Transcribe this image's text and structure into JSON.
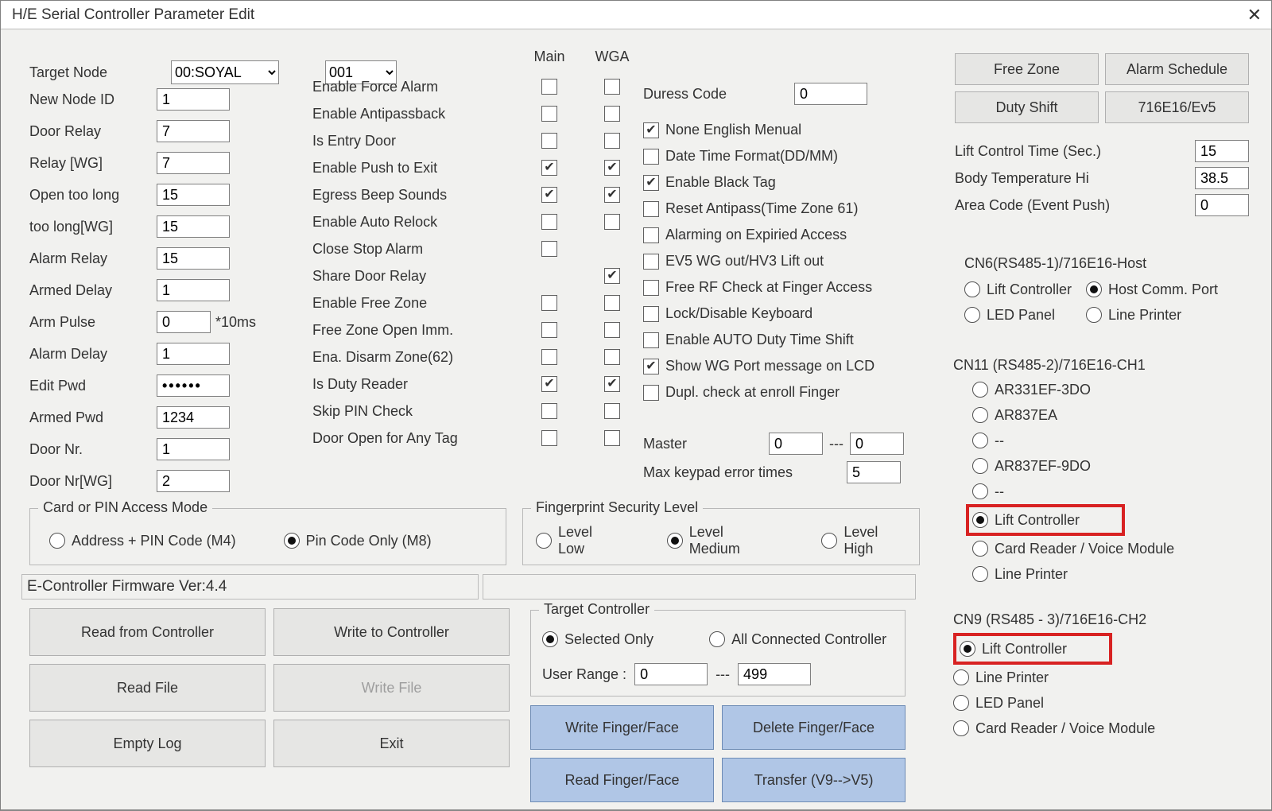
{
  "title": "H/E Serial Controller  Parameter Edit",
  "targetNode": {
    "label": "Target Node",
    "combo1": "00:SOYAL",
    "combo2": "001"
  },
  "leftParams": [
    {
      "label": "New Node ID",
      "value": "1"
    },
    {
      "label": "Door Relay",
      "value": "7"
    },
    {
      "label": "Relay [WG]",
      "value": "7"
    },
    {
      "label": "Open too long",
      "value": "15"
    },
    {
      "label": "too long[WG]",
      "value": "15"
    },
    {
      "label": "Alarm Relay",
      "value": "15"
    },
    {
      "label": "Armed Delay",
      "value": "1"
    },
    {
      "label": "Arm Pulse",
      "value": "0",
      "suffix": "*10ms",
      "narrow": true
    },
    {
      "label": "Alarm Delay",
      "value": "1"
    },
    {
      "label": "Edit Pwd",
      "value": "••••••",
      "pw": true
    },
    {
      "label": "Armed Pwd",
      "value": "1234"
    },
    {
      "label": "Door Nr.",
      "value": "1"
    },
    {
      "label": "Door Nr[WG]",
      "value": "2"
    }
  ],
  "midHdr": {
    "main": "Main",
    "wga": "WGA"
  },
  "midRows": [
    {
      "label": "Enable Force Alarm",
      "m": false,
      "w": false
    },
    {
      "label": "Enable Antipassback",
      "m": false,
      "w": false
    },
    {
      "label": "Is Entry Door",
      "m": false,
      "w": false
    },
    {
      "label": "Enable Push to Exit",
      "m": true,
      "w": true
    },
    {
      "label": "Egress Beep Sounds",
      "m": true,
      "w": true
    },
    {
      "label": "Enable Auto Relock",
      "m": false,
      "w": false
    },
    {
      "label": "Close Stop Alarm",
      "m": false,
      "noW": true
    },
    {
      "label": "Share Door Relay",
      "m": false,
      "w": true,
      "noM": false,
      "onlyW": true
    },
    {
      "label": "Enable Free Zone",
      "m": false,
      "w": false
    },
    {
      "label": "Free Zone Open Imm.",
      "m": false,
      "w": false
    },
    {
      "label": "Ena. Disarm Zone(62)",
      "m": false,
      "w": false
    },
    {
      "label": "Is Duty Reader",
      "m": true,
      "w": true
    },
    {
      "label": "Skip PIN Check",
      "m": false,
      "w": false
    },
    {
      "label": "Door Open for Any Tag",
      "m": false,
      "w": false
    }
  ],
  "col3top": {
    "duressLabel": "Duress Code",
    "duressVal": "0"
  },
  "col3checks": [
    {
      "label": "None English Menual",
      "ck": true
    },
    {
      "label": "Date Time Format(DD/MM)",
      "ck": false
    },
    {
      "label": "Enable Black Tag",
      "ck": true
    },
    {
      "label": "Reset Antipass(Time Zone 61)",
      "ck": false
    },
    {
      "label": "Alarming on Expiried Access",
      "ck": false
    },
    {
      "label": "EV5 WG out/HV3 Lift out",
      "ck": false
    },
    {
      "label": "Free RF Check at Finger Access",
      "ck": false
    },
    {
      "label": "Lock/Disable Keyboard",
      "ck": false
    },
    {
      "label": "Enable AUTO Duty Time Shift",
      "ck": false
    },
    {
      "label": "Show WG Port message on LCD",
      "ck": true
    },
    {
      "label": "Dupl. check at enroll  Finger",
      "ck": false
    }
  ],
  "master": {
    "label": "Master",
    "a": "0",
    "sep": "---",
    "b": "0"
  },
  "maxKeypad": {
    "label": "Max keypad error times",
    "val": "5"
  },
  "topRightBtns": [
    "Free Zone",
    "Alarm Schedule",
    "Duty Shift",
    "716E16/Ev5"
  ],
  "right2": [
    {
      "label": "Lift Control Time (Sec.)",
      "val": "15"
    },
    {
      "label": "Body Temperature Hi",
      "val": "38.5"
    },
    {
      "label": "Area Code (Event Push)",
      "val": "0"
    }
  ],
  "cn6": {
    "legend": "CN6(RS485-1)/716E16-Host",
    "opts": [
      {
        "label": "Lift Controller",
        "sel": false
      },
      {
        "label": "Host Comm. Port",
        "sel": true
      },
      {
        "label": "LED Panel",
        "sel": false
      },
      {
        "label": "Line Printer",
        "sel": false
      }
    ]
  },
  "cn11": {
    "legend": "CN11 (RS485-2)/716E16-CH1",
    "opts": [
      "AR331EF-3DO",
      "AR837EA",
      "--",
      "AR837EF-9DO",
      "--",
      "Lift Controller",
      "Card Reader / Voice Module",
      "Line Printer"
    ],
    "sel": 5
  },
  "cn9": {
    "legend": "CN9 (RS485 - 3)/716E16-CH2",
    "opts": [
      "Lift Controller",
      "Line Printer",
      "LED Panel",
      "Card Reader / Voice Module"
    ],
    "sel": 0
  },
  "accessMode": {
    "legend": "Card or PIN Access Mode",
    "opts": [
      "Address + PIN Code (M4)",
      "Pin Code Only (M8)"
    ],
    "sel": 1
  },
  "fpLevel": {
    "legend": "Fingerprint Security Level",
    "opts": [
      "Level Low",
      "Level Medium",
      "Level High"
    ],
    "sel": 1
  },
  "firmware": "E-Controller Firmware Ver:4.4",
  "botLeft": [
    "Read from Controller",
    "Write to Controller",
    "Read File",
    "Write File",
    "Empty Log",
    "Exit"
  ],
  "targetCtrl": {
    "legend": "Target Controller",
    "opts": [
      "Selected Only",
      "All Connected Controller"
    ],
    "sel": 0,
    "userRangeLabel": "User Range  :",
    "a": "0",
    "sep": "---",
    "b": "499"
  },
  "botBlue": [
    "Write Finger/Face",
    "Delete Finger/Face",
    "Read Finger/Face",
    "Transfer (V9-->V5)"
  ]
}
